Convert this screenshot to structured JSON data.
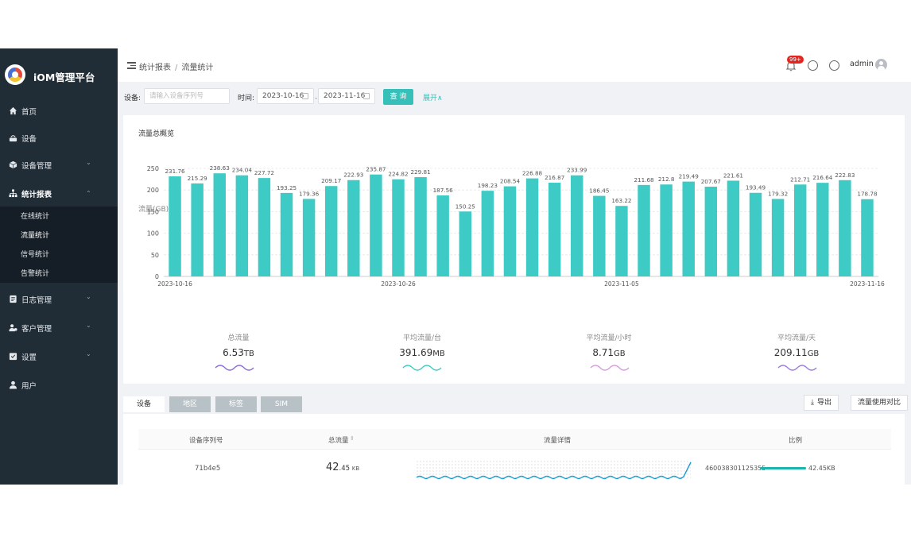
{
  "app": {
    "brand": "iOM管理平台"
  },
  "sidebar": {
    "items": [
      {
        "label": "首页",
        "icon": "home-icon"
      },
      {
        "label": "设备",
        "icon": "device-icon"
      },
      {
        "label": "设备管理",
        "icon": "cube-icon",
        "expandable": true
      },
      {
        "label": "统计报表",
        "icon": "sitemap-icon",
        "expandable": true,
        "active": true
      },
      {
        "label": "日志管理",
        "icon": "log-icon",
        "expandable": true
      },
      {
        "label": "客户管理",
        "icon": "customer-icon",
        "expandable": true
      },
      {
        "label": "设置",
        "icon": "settings-icon",
        "expandable": true
      },
      {
        "label": "用户",
        "icon": "user-icon"
      }
    ],
    "subitems": [
      "在线统计",
      "流量统计",
      "信号统计",
      "告警统计"
    ]
  },
  "header": {
    "breadcrumb": [
      "统计报表",
      "流量统计"
    ],
    "notification_badge": "99+",
    "username": "admin"
  },
  "filters": {
    "device_label": "设备:",
    "device_placeholder": "请输入设备序列号",
    "time_label": "时间:",
    "start_date": "2023-10-16",
    "end_date": "2023-11-16",
    "date_separator": "-",
    "query_button": "查 询",
    "expand_link": "展开∧"
  },
  "overview": {
    "title": "流量总概览",
    "stats": [
      {
        "label": "总流量",
        "value": "6.53",
        "unit": "TB"
      },
      {
        "label": "平均流量/台",
        "value": "391.69",
        "unit": "MB"
      },
      {
        "label": "平均流量/小时",
        "value": "8.71",
        "unit": "GB"
      },
      {
        "label": "平均流量/天",
        "value": "209.11",
        "unit": "GB"
      }
    ]
  },
  "chart_data": {
    "type": "bar",
    "title": "",
    "ylabel": "流量(GB)",
    "xlabel": "",
    "ylim": [
      0,
      250
    ],
    "yticks": [
      0,
      50,
      100,
      150,
      200,
      250
    ],
    "grid": true,
    "color": "#3ecbc6",
    "x_tick_labels": [
      {
        "index": 0,
        "label": "2023-10-16"
      },
      {
        "index": 10,
        "label": "2023-10-26"
      },
      {
        "index": 20,
        "label": "2023-11-05"
      },
      {
        "index": 31,
        "label": "2023-11-16"
      }
    ],
    "values": [
      231.76,
      215.29,
      238.63,
      234.04,
      227.72,
      193.25,
      179.36,
      209.17,
      222.93,
      235.87,
      224.82,
      229.81,
      187.56,
      150.25,
      198.23,
      208.54,
      226.88,
      216.87,
      233.99,
      186.45,
      163.22,
      211.68,
      212.8,
      219.49,
      207.67,
      221.61,
      193.49,
      179.32,
      212.71,
      216.64,
      222.83,
      178.78
    ]
  },
  "tabs": [
    {
      "label": "设备",
      "active": true
    },
    {
      "label": "地区",
      "active": false
    },
    {
      "label": "标签",
      "active": false
    },
    {
      "label": "SIM",
      "active": false
    }
  ],
  "actions": {
    "export": "导出",
    "compare": "流量使用对比"
  },
  "table": {
    "columns": [
      "设备序列号",
      "总流量",
      "流量详情",
      "比例"
    ],
    "rows": [
      {
        "device": "71b4e5",
        "total_int": "42",
        "total_dec": ".45",
        "total_unit": "KB",
        "sim": "460038301125355",
        "ratio_value": "42.45KB",
        "ratio": 1.0
      }
    ]
  }
}
